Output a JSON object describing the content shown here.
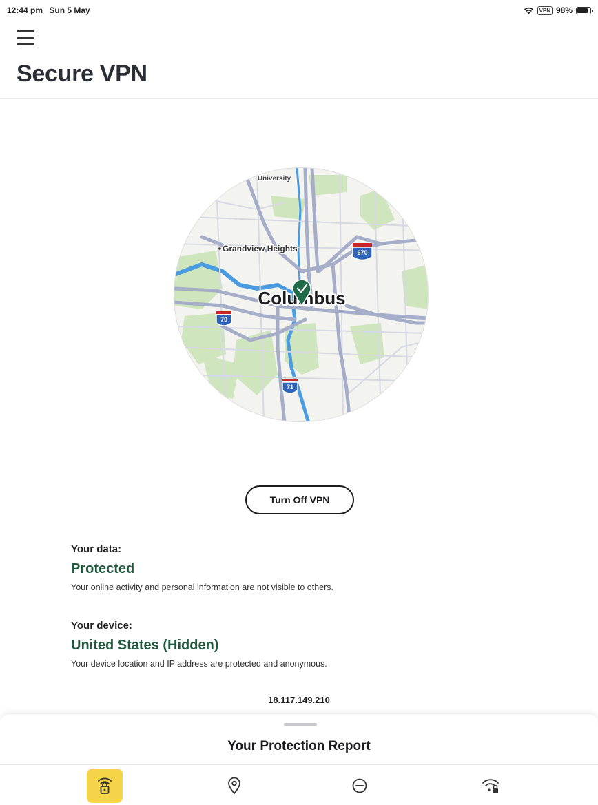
{
  "status_bar": {
    "time": "12:44 pm",
    "date": "Sun 5 May",
    "vpn_badge": "VPN",
    "battery": "98%"
  },
  "header": {
    "title": "Secure VPN",
    "menu_icon": "hamburger-menu-icon"
  },
  "map": {
    "city": "Columbus",
    "labels": {
      "university": "University",
      "grandview": "Grandview Heights"
    },
    "shields": [
      "670",
      "70",
      "71"
    ],
    "marker_icon": "check-location-pin-icon"
  },
  "vpn_button": {
    "label": "Turn Off VPN"
  },
  "data_status": {
    "label": "Your data:",
    "value": "Protected",
    "description": "Your online activity and personal information are not visible to others."
  },
  "device_status": {
    "label": "Your device:",
    "value": "United States (Hidden)",
    "description": "Your device location and IP address are protected and anonymous."
  },
  "ip_address": "18.117.149.210",
  "bottom_sheet": {
    "title": "Your Protection Report"
  },
  "tabs": [
    {
      "icon": "wifi-lock-shield-icon",
      "active": true
    },
    {
      "icon": "location-pin-icon",
      "active": false
    },
    {
      "icon": "block-icon",
      "active": false
    },
    {
      "icon": "wifi-lock-icon",
      "active": false
    }
  ],
  "colors": {
    "accent_green": "#1f5a3f",
    "active_tab": "#f6d44a",
    "map_road": "#a6adc8",
    "map_park": "#c9e2b4",
    "map_water": "#4b9be0"
  }
}
